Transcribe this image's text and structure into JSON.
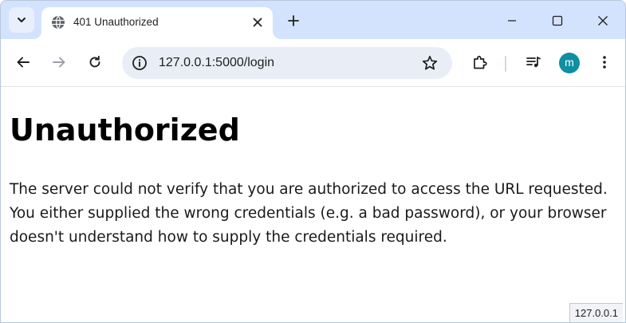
{
  "browser": {
    "tab": {
      "title": "401 Unauthorized",
      "favicon": "globe-icon"
    },
    "new_tab_icon": "plus-icon",
    "address": {
      "url": "127.0.0.1:5000/login",
      "site_info_icon": "info-icon",
      "bookmark_icon": "star-icon"
    },
    "profile": {
      "initial": "m",
      "color": "#0e8fa3"
    },
    "theme": {
      "tabstrip_bg": "#d3e3fd",
      "omnibox_bg": "#e9eef6"
    }
  },
  "page": {
    "heading": "Unauthorized",
    "body": "The server could not verify that you are authorized to access the URL requested. You either supplied the wrong credentials (e.g. a bad password), or your browser doesn't understand how to supply the credentials required."
  },
  "status_bar": {
    "text": "127.0.0.1"
  }
}
